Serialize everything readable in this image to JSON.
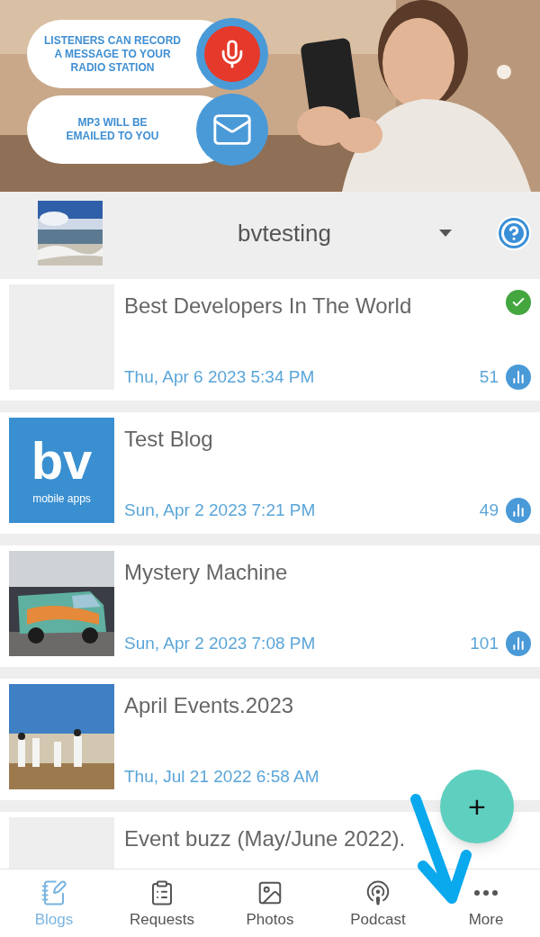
{
  "banner": {
    "kind": "picture",
    "callouts": [
      {
        "kind": "mic",
        "lines": [
          "LISTENERS CAN RECORD",
          "A MESSAGE TO YOUR",
          "RADIO STATION"
        ]
      },
      {
        "kind": "mail",
        "lines": [
          "MP3 WILL BE",
          "EMAILED TO YOU"
        ]
      }
    ]
  },
  "header": {
    "station": "bvtesting"
  },
  "posts": [
    {
      "title": "Best Developers In The World",
      "date": "Thu, Apr 6 2023 5:34 PM",
      "count": "51",
      "verified": true,
      "thumb": {
        "kind": "blank"
      }
    },
    {
      "title": "Test Blog",
      "date": "Sun, Apr 2 2023 7:21 PM",
      "count": "49",
      "verified": false,
      "thumb": {
        "kind": "logo",
        "mark": "bv",
        "caption": "mobile apps"
      }
    },
    {
      "title": "Mystery Machine",
      "date": "Sun, Apr 2 2023 7:08 PM",
      "count": "101",
      "verified": false,
      "thumb": {
        "kind": "van"
      }
    },
    {
      "title": "April Events.2023",
      "date": "Thu, Jul 21 2022 6:58 AM",
      "verified": false,
      "thumb": {
        "kind": "crowd"
      }
    },
    {
      "title": "Event buzz (May/June 2022).",
      "verified": false,
      "thumb": {
        "kind": "blank"
      }
    }
  ],
  "fab": {
    "label": "+"
  },
  "nav": [
    {
      "label": "Blogs",
      "kind": "blogs",
      "selected": true
    },
    {
      "label": "Requests",
      "kind": "requests",
      "selected": false
    },
    {
      "label": "Photos",
      "kind": "photos",
      "selected": false
    },
    {
      "label": "Podcast",
      "kind": "podcast",
      "selected": false
    },
    {
      "label": "More",
      "kind": "more",
      "selected": false
    }
  ]
}
